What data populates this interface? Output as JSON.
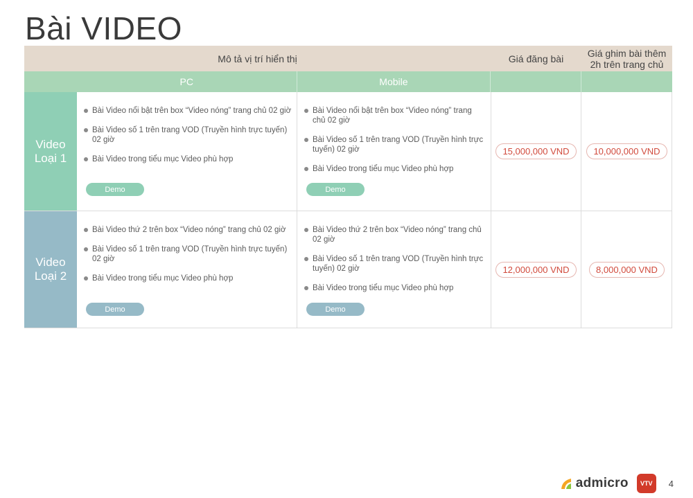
{
  "title": "Bài VIDEO",
  "header": {
    "description": "Mô tả vị trí hiển thị",
    "price": "Giá đăng bài",
    "pin_line1": "Giá ghim bài thêm",
    "pin_line2": "2h trên trang chủ",
    "pc": "PC",
    "mobile": "Mobile"
  },
  "rows": [
    {
      "label_line1": "Video",
      "label_line2": "Loại 1",
      "pc_items": [
        "Bài Video nổi bật trên box “Video nóng” trang chủ 02 giờ",
        "Bài Video số 1 trên trang VOD (Truyền hình trực tuyến) 02 giờ",
        "Bài Video trong tiểu mục Video phù hợp"
      ],
      "mobile_items": [
        "Bài Video nổi bật trên box “Video nóng” trang chủ 02 giờ",
        "Bài Video số 1 trên trang VOD (Truyền hình trực tuyến) 02 giờ",
        "Bài Video trong tiểu mục Video phù hợp"
      ],
      "demo_label": "Demo",
      "price": "15,000,000 VND",
      "pin_price": "10,000,000 VND"
    },
    {
      "label_line1": "Video",
      "label_line2": "Loại 2",
      "pc_items": [
        "Bài Video thứ 2 trên box “Video nóng” trang chủ 02 giờ",
        "Bài Video số 1 trên trang VOD (Truyền hình trực tuyến) 02 giờ",
        "Bài Video trong tiểu mục Video phù hợp"
      ],
      "mobile_items": [
        "Bài Video thứ 2 trên box “Video nóng” trang chủ 02 giờ",
        "Bài Video số 1 trên trang VOD (Truyền hình trực tuyến) 02 giờ",
        "Bài Video trong tiểu mục Video phù hợp"
      ],
      "demo_label": "Demo",
      "price": "12,000,000 VND",
      "pin_price": "8,000,000 VND"
    }
  ],
  "footer": {
    "brand": "admicro",
    "logo2_text": "VTV",
    "page_number": "4"
  },
  "colors": {
    "header_beige": "#e4d9cd",
    "header_green": "#a9d6b6",
    "row1_label": "#8fcfb5",
    "row2_label": "#96bac7",
    "price_red": "#d14a3c"
  }
}
